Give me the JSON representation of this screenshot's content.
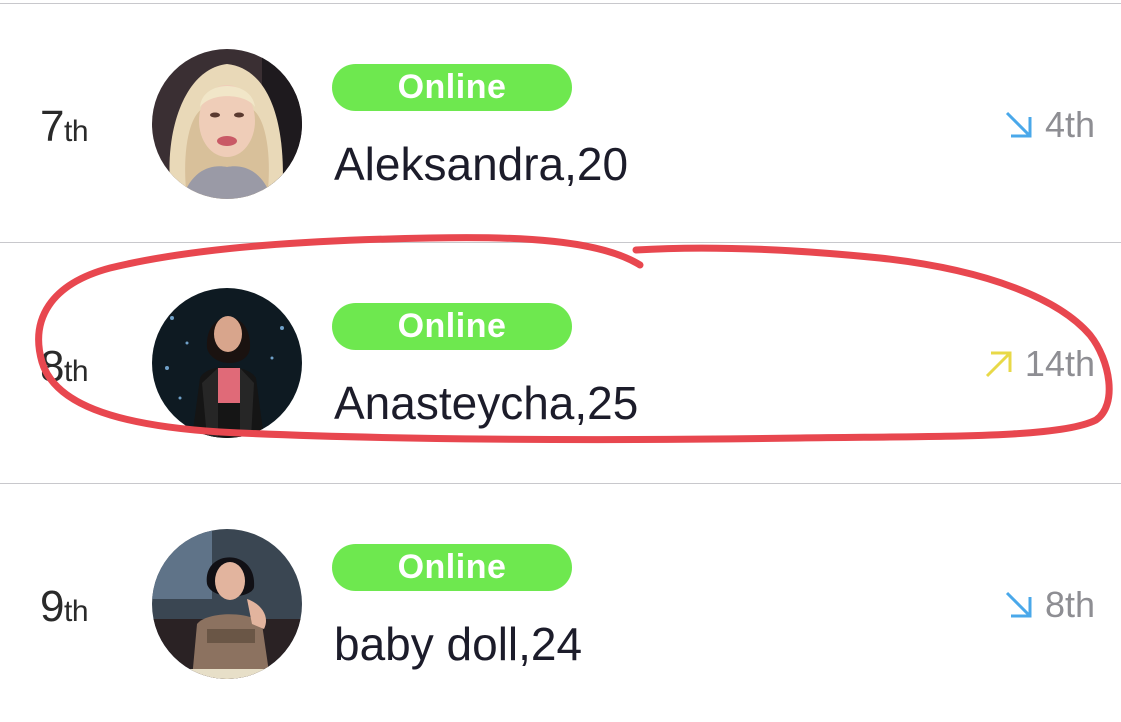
{
  "rows": [
    {
      "rank_num": "7",
      "rank_suffix": "th",
      "status": "Online",
      "name": "Aleksandra,20",
      "trend_direction": "down",
      "trend_color": "#4aa8ea",
      "previous_rank": "4th"
    },
    {
      "rank_num": "8",
      "rank_suffix": "th",
      "status": "Online",
      "name": "Anasteycha,25",
      "trend_direction": "up",
      "trend_color": "#e8d948",
      "previous_rank": "14th"
    },
    {
      "rank_num": "9",
      "rank_suffix": "th",
      "status": "Online",
      "name": "baby doll,24",
      "trend_direction": "down",
      "trend_color": "#4aa8ea",
      "previous_rank": "8th"
    }
  ],
  "colors": {
    "online_badge": "#6ee84f",
    "annotation_circle": "#e8474f",
    "divider": "#c8c8cc"
  }
}
